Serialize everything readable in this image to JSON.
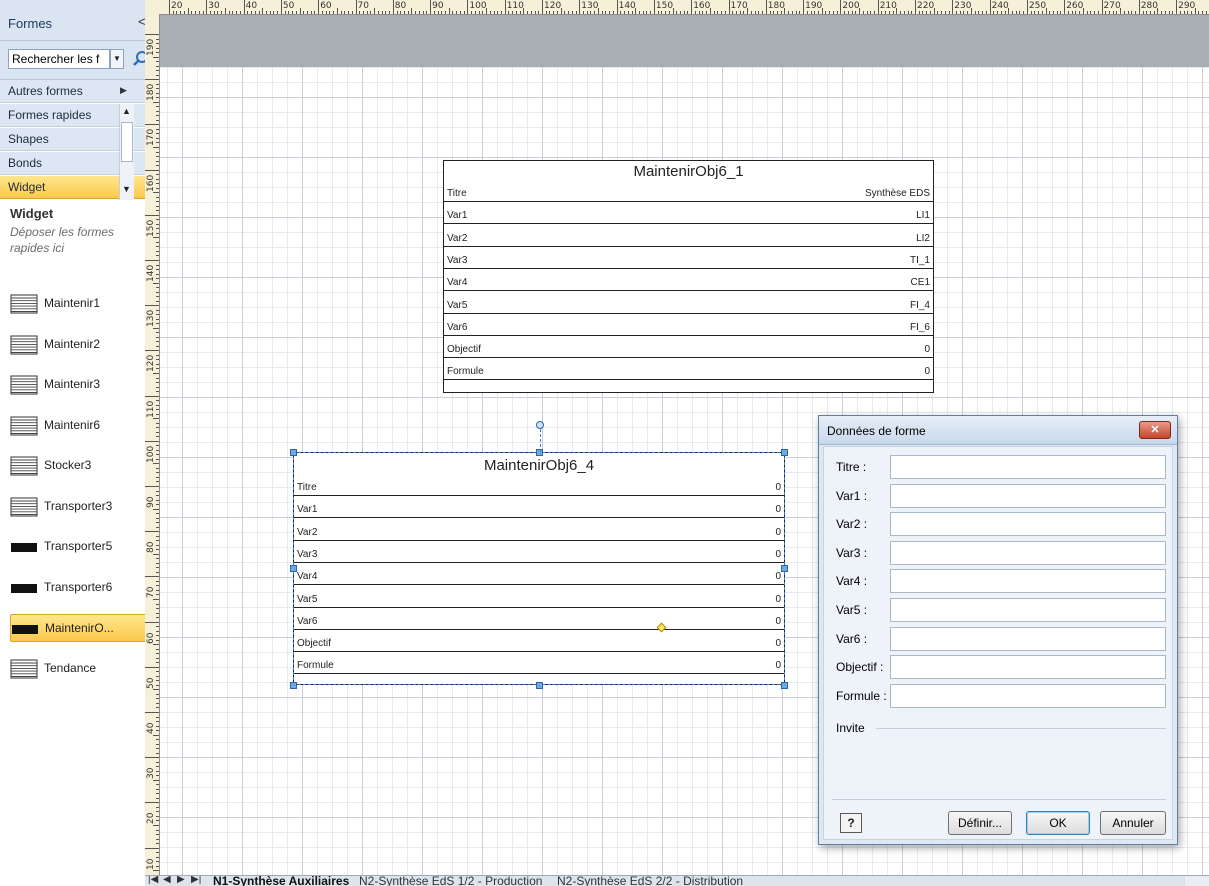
{
  "panel": {
    "title": "Formes",
    "collapse_glyph": "<",
    "search_value": "Rechercher les f",
    "search_icon": "magnifier-icon",
    "stencils": [
      {
        "label": "Autres formes",
        "arrow": "▶"
      },
      {
        "label": "Formes rapides",
        "arrow": "▲"
      },
      {
        "label": "Shapes",
        "arrow": ""
      },
      {
        "label": "Bonds",
        "arrow": ""
      },
      {
        "label": "Widget",
        "arrow": "▼"
      }
    ],
    "widget_header": "Widget",
    "widget_desc": "Déposer les formes rapides ici",
    "shapes": [
      {
        "name": "Maintenir1",
        "icon": "table-icon"
      },
      {
        "name": "Maintenir2",
        "icon": "table-icon"
      },
      {
        "name": "Maintenir3",
        "icon": "table-icon"
      },
      {
        "name": "Maintenir6",
        "icon": "table-icon"
      },
      {
        "name": "Stocker3",
        "icon": "table-icon"
      },
      {
        "name": "Transporter3",
        "icon": "table-icon"
      },
      {
        "name": "Transporter5",
        "icon": "bar-icon"
      },
      {
        "name": "Transporter6",
        "icon": "bar-icon"
      },
      {
        "name": "MaintenirO...",
        "icon": "bar-icon"
      },
      {
        "name": "Tendance",
        "icon": "table-icon"
      }
    ]
  },
  "ruler": {
    "top": [
      "20",
      "30",
      "40",
      "50",
      "60",
      "70",
      "80",
      "90",
      "100",
      "110",
      "120",
      "130",
      "140",
      "150",
      "160",
      "170",
      "180",
      "190",
      "200",
      "210",
      "220",
      "230",
      "240",
      "250",
      "260",
      "270",
      "280",
      "290"
    ],
    "left": [
      "190",
      "180",
      "170",
      "160",
      "150",
      "140",
      "130",
      "120",
      "110",
      "100",
      "90",
      "80",
      "70",
      "60",
      "50",
      "40",
      "30",
      "20",
      "10"
    ]
  },
  "shape1": {
    "title": "MaintenirObj6_1",
    "rows": [
      {
        "key": "Titre",
        "value": "Synthèse EDS"
      },
      {
        "key": "Var1",
        "value": "LI1"
      },
      {
        "key": "Var2",
        "value": "LI2"
      },
      {
        "key": "Var3",
        "value": "TI_1"
      },
      {
        "key": "Var4",
        "value": "CE1"
      },
      {
        "key": "Var5",
        "value": "FI_4"
      },
      {
        "key": "Var6",
        "value": "FI_6"
      },
      {
        "key": "Objectif",
        "value": "0"
      },
      {
        "key": "Formule",
        "value": "0"
      }
    ]
  },
  "shape2": {
    "title": "MaintenirObj6_4",
    "rows": [
      {
        "key": "Titre",
        "value": "0"
      },
      {
        "key": "Var1",
        "value": "0"
      },
      {
        "key": "Var2",
        "value": "0"
      },
      {
        "key": "Var3",
        "value": "0"
      },
      {
        "key": "Var4",
        "value": "0"
      },
      {
        "key": "Var5",
        "value": "0"
      },
      {
        "key": "Var6",
        "value": "0"
      },
      {
        "key": "Objectif",
        "value": "0"
      },
      {
        "key": "Formule",
        "value": "0"
      }
    ]
  },
  "dialog": {
    "title": "Données de forme",
    "close_glyph": "✕",
    "fields": [
      {
        "label": "Titre :",
        "value": ""
      },
      {
        "label": "Var1 :",
        "value": ""
      },
      {
        "label": "Var2 :",
        "value": ""
      },
      {
        "label": "Var3 :",
        "value": ""
      },
      {
        "label": "Var4 :",
        "value": ""
      },
      {
        "label": "Var5 :",
        "value": ""
      },
      {
        "label": "Var6 :",
        "value": ""
      },
      {
        "label": "Objectif :",
        "value": ""
      },
      {
        "label": "Formule :",
        "value": ""
      }
    ],
    "invite_label": "Invite",
    "help_glyph": "?",
    "buttons": {
      "define": "Définir...",
      "ok": "OK",
      "cancel": "Annuler"
    }
  },
  "tabs": {
    "nav": [
      "|◀",
      "◀",
      "▶",
      "▶|"
    ],
    "items": [
      {
        "label": "N1-Synthèse Auxiliaires",
        "active": true
      },
      {
        "label": "N2-Synthèse EdS 1/2 - Production",
        "active": false
      },
      {
        "label": "N2-Synthèse EdS 2/2 - Distribution",
        "active": false
      }
    ]
  }
}
